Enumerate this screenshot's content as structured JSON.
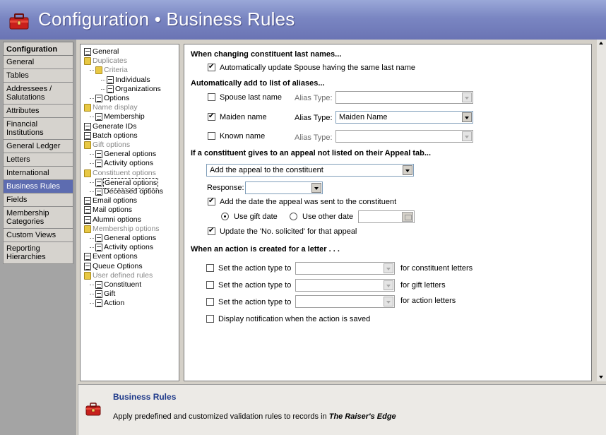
{
  "window": {
    "title_main": "Configuration",
    "title_sep": "•",
    "title_sub": "Business Rules",
    "icon": "toolbox-icon"
  },
  "nav": {
    "heading": "Configuration",
    "items": [
      {
        "label": "General",
        "active": false
      },
      {
        "label": "Tables",
        "active": false
      },
      {
        "label": "Addressees / Salutations",
        "active": false
      },
      {
        "label": "Attributes",
        "active": false
      },
      {
        "label": "Financial Institutions",
        "active": false
      },
      {
        "label": "General Ledger",
        "active": false
      },
      {
        "label": "Letters",
        "active": false
      },
      {
        "label": "International",
        "active": false
      },
      {
        "label": "Business Rules",
        "active": true
      },
      {
        "label": "Fields",
        "active": false
      },
      {
        "label": "Membership Categories",
        "active": false
      },
      {
        "label": "Custom Views",
        "active": false
      },
      {
        "label": "Reporting Hierarchies",
        "active": false
      }
    ],
    "active_color": "#5d6cb0"
  },
  "tree": {
    "items": [
      {
        "label": "General",
        "type": "doc",
        "level": 0
      },
      {
        "label": "Duplicates",
        "type": "folder",
        "level": 0,
        "dim": true
      },
      {
        "label": "Criteria",
        "type": "folder",
        "level": 1,
        "dim": true
      },
      {
        "label": "Individuals",
        "type": "doc",
        "level": 2
      },
      {
        "label": "Organizations",
        "type": "doc",
        "level": 2
      },
      {
        "label": "Options",
        "type": "doc",
        "level": 1
      },
      {
        "label": "Name display",
        "type": "folder",
        "level": 0,
        "dim": true
      },
      {
        "label": "Membership",
        "type": "doc",
        "level": 1
      },
      {
        "label": "Generate IDs",
        "type": "doc",
        "level": 0
      },
      {
        "label": "Batch options",
        "type": "doc",
        "level": 0
      },
      {
        "label": "Gift options",
        "type": "folder",
        "level": 0,
        "dim": true
      },
      {
        "label": "General options",
        "type": "doc",
        "level": 1
      },
      {
        "label": "Activity options",
        "type": "doc",
        "level": 1
      },
      {
        "label": "Constituent options",
        "type": "folder",
        "level": 0,
        "dim": true
      },
      {
        "label": "General options",
        "type": "doc",
        "level": 1,
        "selected": true
      },
      {
        "label": "Deceased options",
        "type": "doc",
        "level": 1
      },
      {
        "label": "Email options",
        "type": "doc",
        "level": 0
      },
      {
        "label": "Mail options",
        "type": "doc",
        "level": 0
      },
      {
        "label": "Alumni options",
        "type": "doc",
        "level": 0
      },
      {
        "label": "Membership options",
        "type": "folder",
        "level": 0,
        "dim": true
      },
      {
        "label": "General options",
        "type": "doc",
        "level": 1
      },
      {
        "label": "Activity options",
        "type": "doc",
        "level": 1
      },
      {
        "label": "Event options",
        "type": "doc",
        "level": 0
      },
      {
        "label": "Queue Options",
        "type": "doc",
        "level": 0
      },
      {
        "label": "User defined rules",
        "type": "folder",
        "level": 0,
        "dim": true
      },
      {
        "label": "Constituent",
        "type": "doc",
        "level": 1
      },
      {
        "label": "Gift",
        "type": "doc",
        "level": 1
      },
      {
        "label": "Action",
        "type": "doc",
        "level": 1
      }
    ]
  },
  "main": {
    "sec_lastname": {
      "heading": "When changing constituent last names...",
      "auto_update_label": "Automatically update Spouse having the same last name",
      "auto_update_checked": true
    },
    "sec_aliases": {
      "heading": "Automatically add to list of aliases...",
      "alias_type_label": "Alias Type:",
      "rows": [
        {
          "label": "Spouse last name",
          "checked": false,
          "alias_value": ""
        },
        {
          "label": "Maiden name",
          "checked": true,
          "alias_value": "Maiden Name"
        },
        {
          "label": "Known name",
          "checked": false,
          "alias_value": ""
        }
      ]
    },
    "sec_appeal": {
      "heading": "If a constituent gives to an appeal not listed on their Appeal tab...",
      "action_value": "Add the appeal to the constituent",
      "response_label": "Response:",
      "response_value": "",
      "add_date_label": "Add the date the appeal was sent to the constituent",
      "add_date_checked": true,
      "use_gift_date_label": "Use gift date",
      "use_other_date_label": "Use other date",
      "selected_date_option": "gift",
      "other_date_value": "",
      "update_solicited_label": "Update the 'No. solicited' for that appeal",
      "update_solicited_checked": true
    },
    "sec_action": {
      "heading": "When an action is created for a letter . . .",
      "set_type_label": "Set the action type to",
      "rows": [
        {
          "suffix": "for constituent letters",
          "checked": false,
          "value": ""
        },
        {
          "suffix": "for gift letters",
          "checked": false,
          "value": ""
        },
        {
          "suffix": "for action letters",
          "checked": false,
          "value": ""
        }
      ],
      "notify_label": "Display notification when the action is saved",
      "notify_checked": false
    }
  },
  "footer": {
    "title": "Business Rules",
    "desc_prefix": "Apply predefined and customized validation rules to records in ",
    "desc_product": "The Raiser's Edge",
    "icon": "toolbox-icon"
  }
}
